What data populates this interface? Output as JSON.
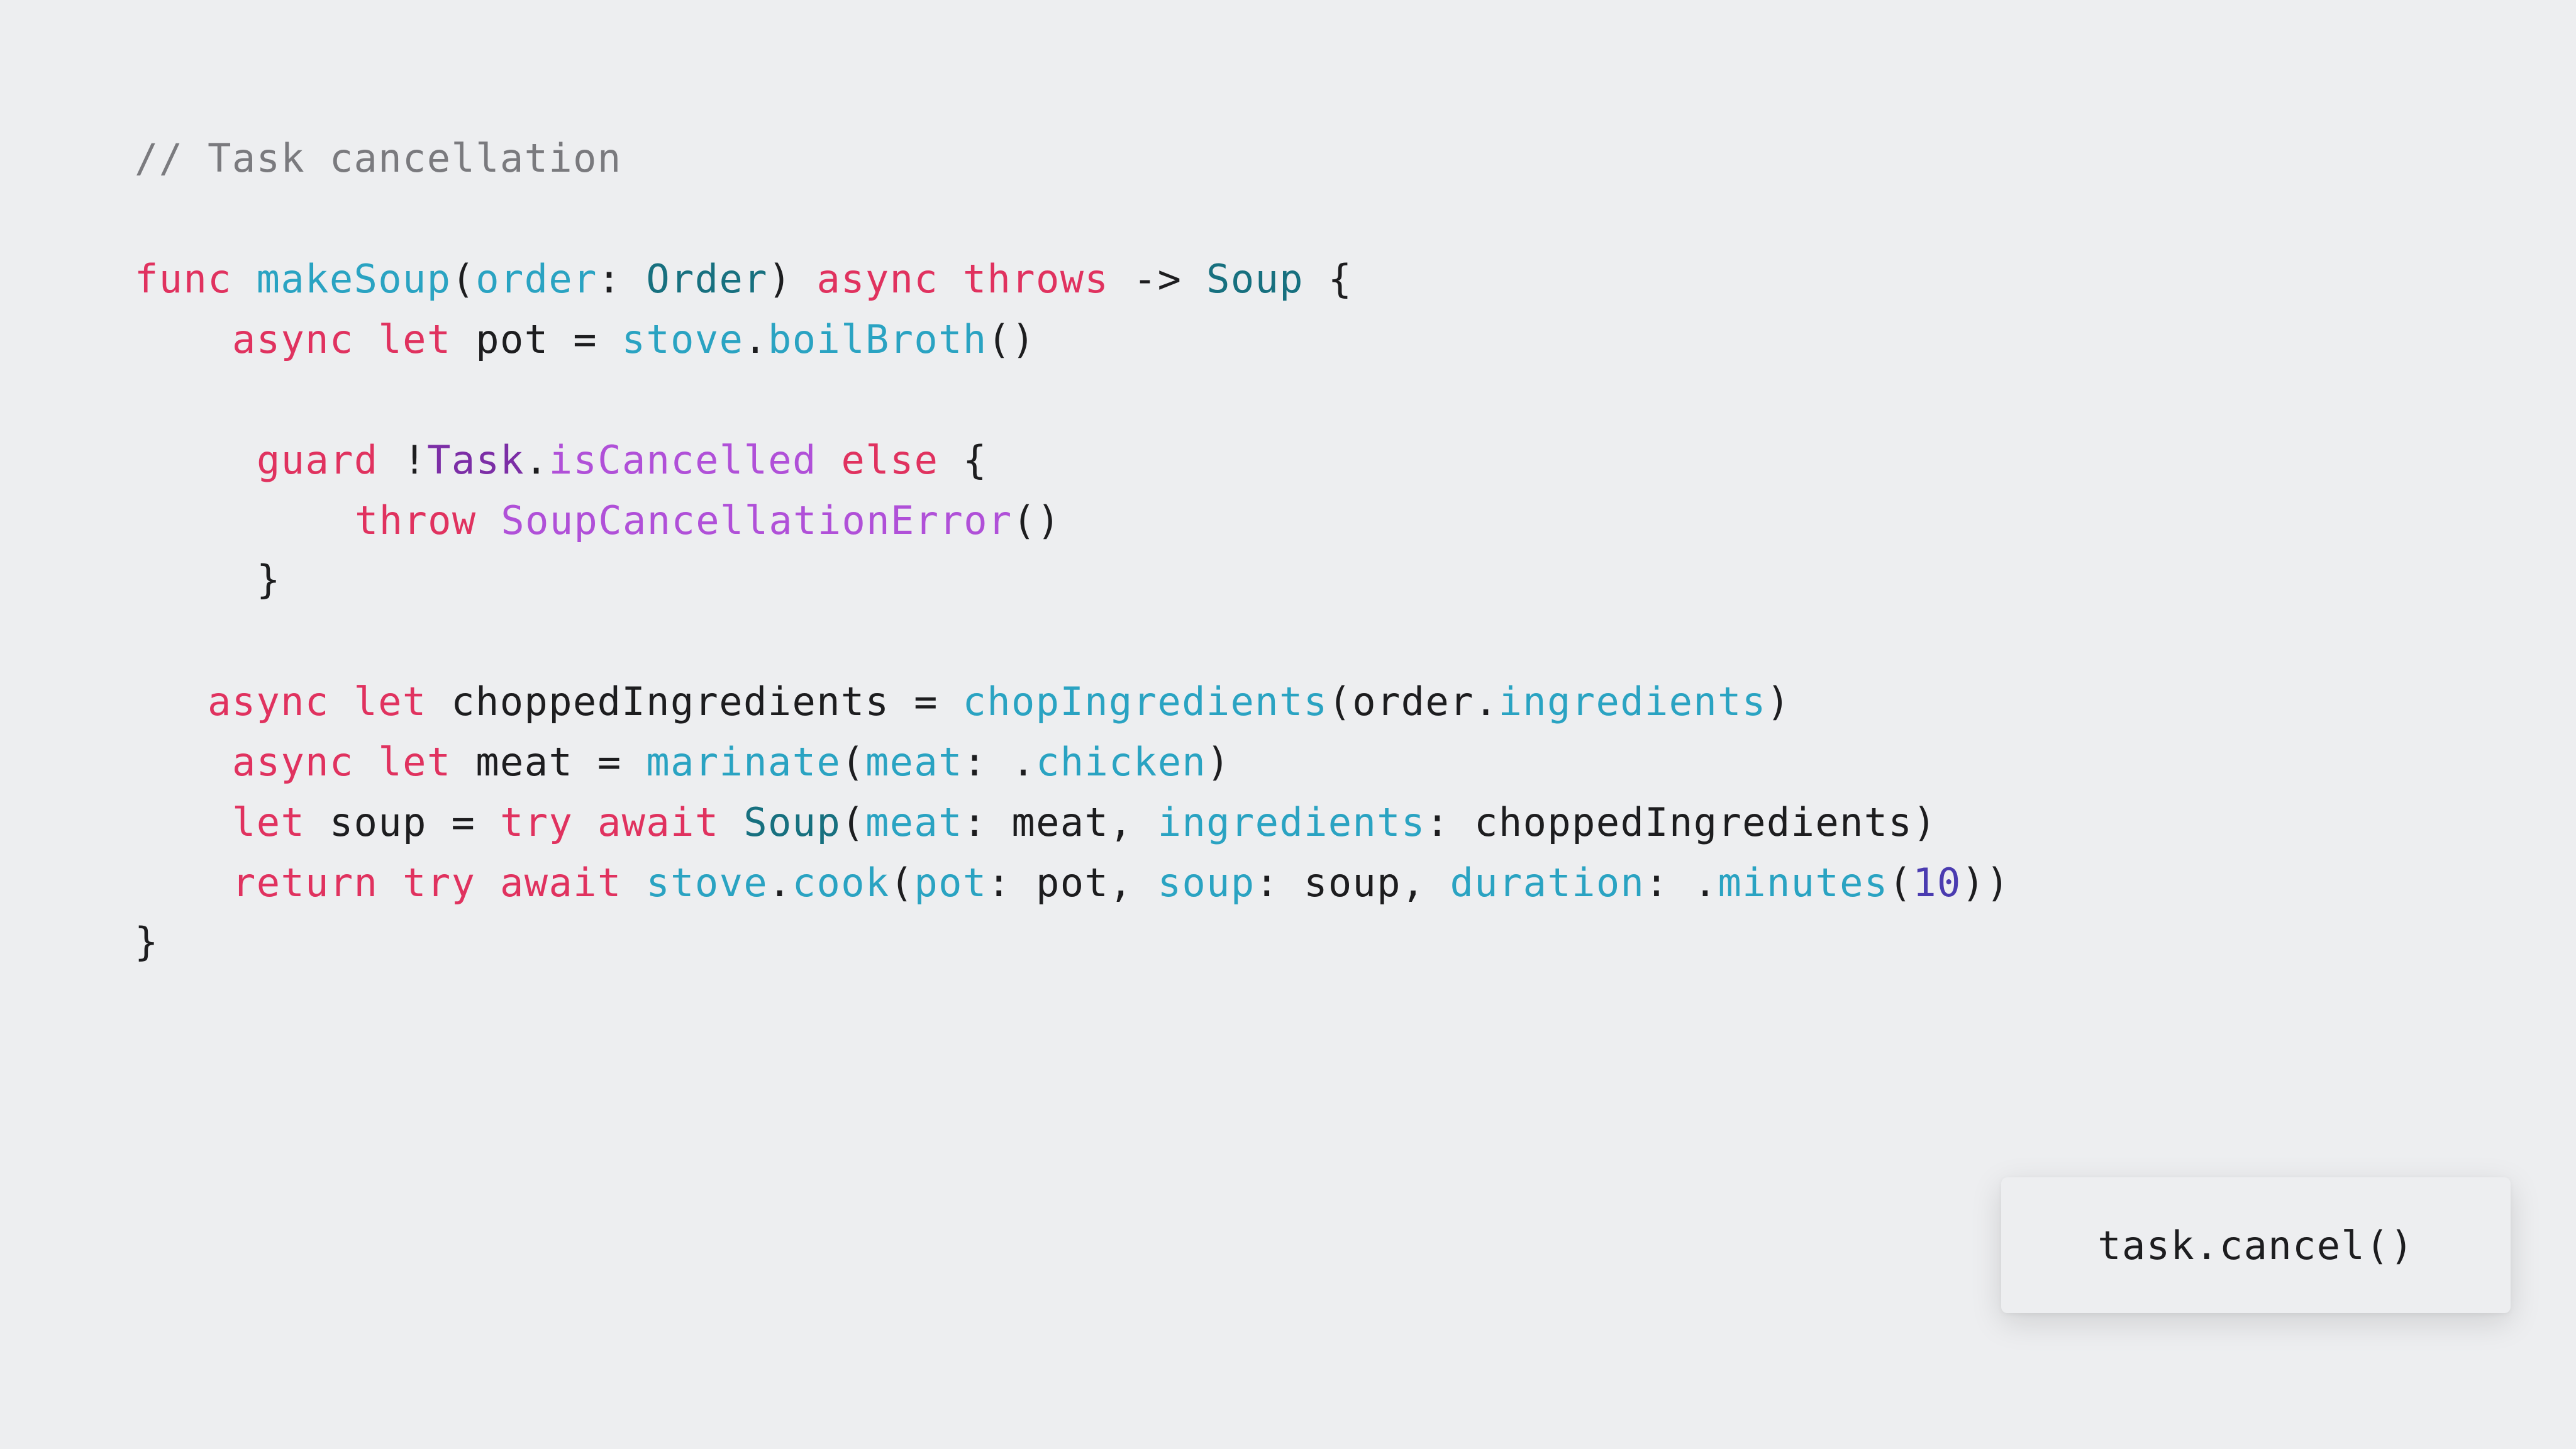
{
  "slide": {
    "comment": "// Task cancellation",
    "code_lines": [
      {
        "id": "func-signature",
        "tokens": [
          {
            "t": "func",
            "k": "keyword"
          },
          {
            "t": " ",
            "k": "plain"
          },
          {
            "t": "makeSoup",
            "k": "fn"
          },
          {
            "t": "(",
            "k": "plain"
          },
          {
            "t": "order",
            "k": "param"
          },
          {
            "t": ": ",
            "k": "plain"
          },
          {
            "t": "Order",
            "k": "type"
          },
          {
            "t": ") ",
            "k": "plain"
          },
          {
            "t": "async",
            "k": "keyword"
          },
          {
            "t": " ",
            "k": "plain"
          },
          {
            "t": "throws",
            "k": "keyword"
          },
          {
            "t": " -> ",
            "k": "plain"
          },
          {
            "t": "Soup",
            "k": "type"
          },
          {
            "t": " {",
            "k": "plain"
          }
        ]
      },
      {
        "id": "async-let-pot",
        "tokens": [
          {
            "t": "async",
            "k": "keyword"
          },
          {
            "t": " ",
            "k": "plain"
          },
          {
            "t": "let",
            "k": "keyword"
          },
          {
            "t": " pot = ",
            "k": "plain"
          },
          {
            "t": "stove",
            "k": "fn"
          },
          {
            "t": ".",
            "k": "plain"
          },
          {
            "t": "boilBroth",
            "k": "fn"
          },
          {
            "t": "()",
            "k": "plain"
          }
        ]
      },
      {
        "id": "guard-line",
        "tokens": [
          {
            "t": "guard",
            "k": "keyword"
          },
          {
            "t": " !",
            "k": "plain"
          },
          {
            "t": "Task",
            "k": "task"
          },
          {
            "t": ".",
            "k": "plain"
          },
          {
            "t": "isCancelled",
            "k": "purple"
          },
          {
            "t": " ",
            "k": "plain"
          },
          {
            "t": "else",
            "k": "keyword"
          },
          {
            "t": " {",
            "k": "plain"
          }
        ]
      },
      {
        "id": "throw-line",
        "tokens": [
          {
            "t": "throw",
            "k": "keyword"
          },
          {
            "t": " ",
            "k": "plain"
          },
          {
            "t": "SoupCancellationError",
            "k": "purple"
          },
          {
            "t": "()",
            "k": "plain"
          }
        ]
      },
      {
        "id": "guard-close",
        "tokens": [
          {
            "t": "}",
            "k": "plain"
          }
        ]
      },
      {
        "id": "async-let-chopped",
        "tokens": [
          {
            "t": "async",
            "k": "keyword"
          },
          {
            "t": " ",
            "k": "plain"
          },
          {
            "t": "let",
            "k": "keyword"
          },
          {
            "t": " choppedIngredients = ",
            "k": "plain"
          },
          {
            "t": "chopIngredients",
            "k": "fn"
          },
          {
            "t": "(order.",
            "k": "plain"
          },
          {
            "t": "ingredients",
            "k": "fn"
          },
          {
            "t": ")",
            "k": "plain"
          }
        ]
      },
      {
        "id": "async-let-meat",
        "tokens": [
          {
            "t": "async",
            "k": "keyword"
          },
          {
            "t": " ",
            "k": "plain"
          },
          {
            "t": "let",
            "k": "keyword"
          },
          {
            "t": " meat = ",
            "k": "plain"
          },
          {
            "t": "marinate",
            "k": "fn"
          },
          {
            "t": "(",
            "k": "plain"
          },
          {
            "t": "meat",
            "k": "param"
          },
          {
            "t": ": .",
            "k": "plain"
          },
          {
            "t": "chicken",
            "k": "fn"
          },
          {
            "t": ")",
            "k": "plain"
          }
        ]
      },
      {
        "id": "let-soup",
        "tokens": [
          {
            "t": "let",
            "k": "keyword"
          },
          {
            "t": " soup = ",
            "k": "plain"
          },
          {
            "t": "try",
            "k": "keyword"
          },
          {
            "t": " ",
            "k": "plain"
          },
          {
            "t": "await",
            "k": "keyword"
          },
          {
            "t": " ",
            "k": "plain"
          },
          {
            "t": "Soup",
            "k": "type"
          },
          {
            "t": "(",
            "k": "plain"
          },
          {
            "t": "meat",
            "k": "param"
          },
          {
            "t": ": meat, ",
            "k": "plain"
          },
          {
            "t": "ingredients",
            "k": "param"
          },
          {
            "t": ": choppedIngredients)",
            "k": "plain"
          }
        ]
      },
      {
        "id": "return-line",
        "tokens": [
          {
            "t": "return",
            "k": "keyword"
          },
          {
            "t": " ",
            "k": "plain"
          },
          {
            "t": "try",
            "k": "keyword"
          },
          {
            "t": " ",
            "k": "plain"
          },
          {
            "t": "await",
            "k": "keyword"
          },
          {
            "t": " ",
            "k": "plain"
          },
          {
            "t": "stove",
            "k": "fn"
          },
          {
            "t": ".",
            "k": "plain"
          },
          {
            "t": "cook",
            "k": "fn"
          },
          {
            "t": "(",
            "k": "plain"
          },
          {
            "t": "pot",
            "k": "param"
          },
          {
            "t": ": pot, ",
            "k": "plain"
          },
          {
            "t": "soup",
            "k": "param"
          },
          {
            "t": ": soup, ",
            "k": "plain"
          },
          {
            "t": "duration",
            "k": "param"
          },
          {
            "t": ": .",
            "k": "plain"
          },
          {
            "t": "minutes",
            "k": "fn"
          },
          {
            "t": "(",
            "k": "plain"
          },
          {
            "t": "10",
            "k": "number"
          },
          {
            "t": "))",
            "k": "plain"
          }
        ]
      },
      {
        "id": "func-close",
        "tokens": [
          {
            "t": "}",
            "k": "plain"
          }
        ]
      }
    ],
    "cancel_card": {
      "label": "task.cancel()"
    }
  }
}
